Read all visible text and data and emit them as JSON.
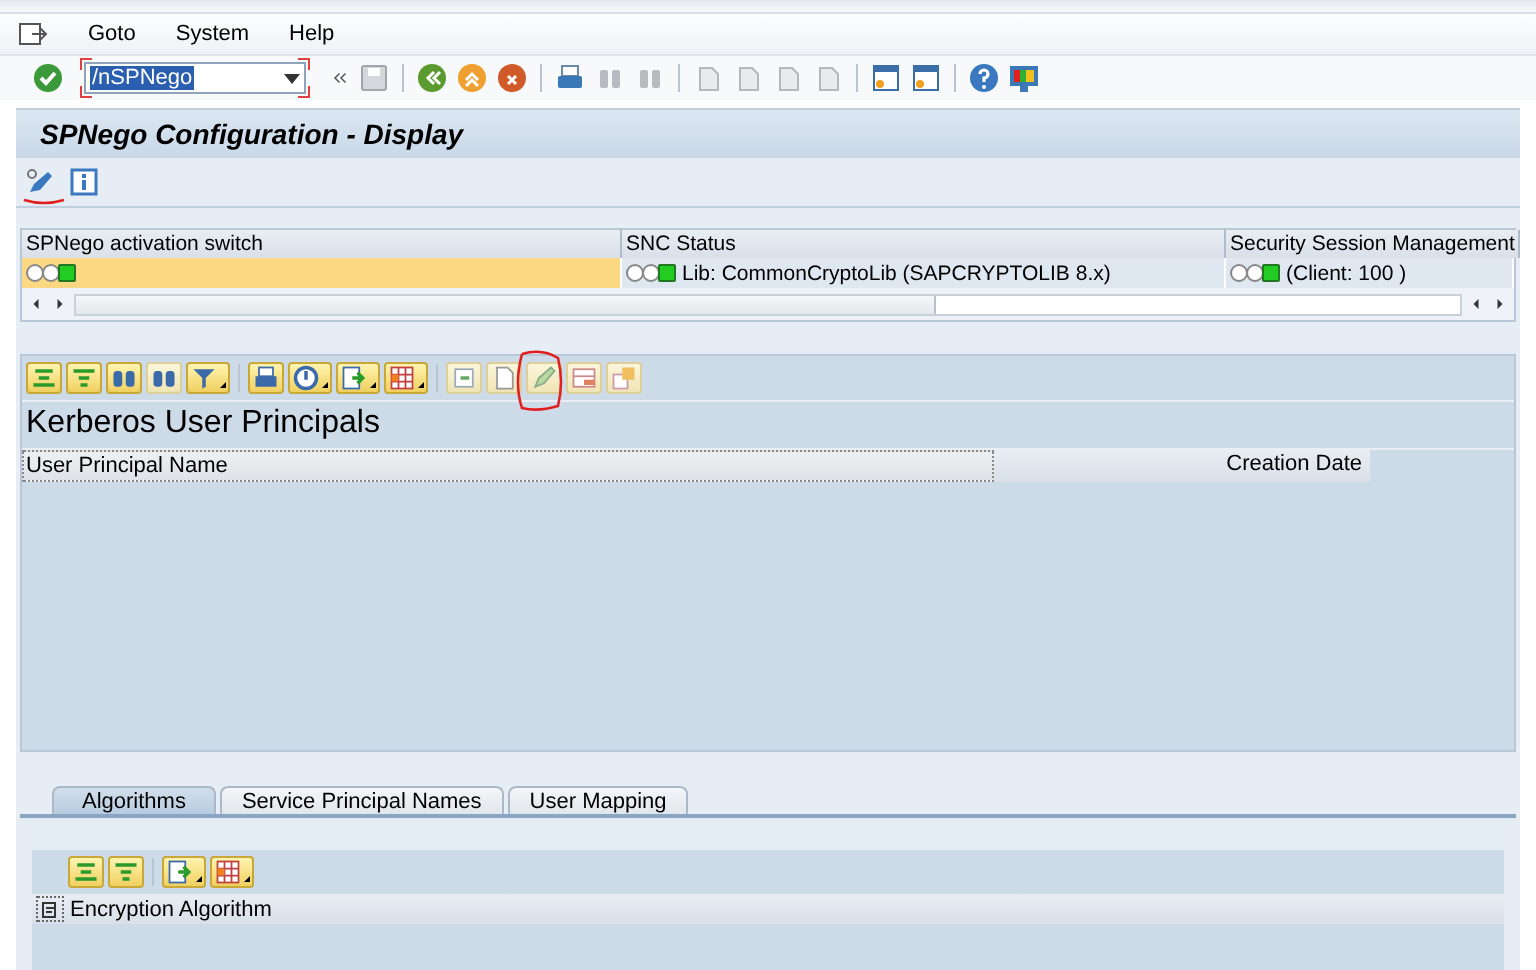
{
  "menu": [
    {
      "label": "Goto"
    },
    {
      "label": "System"
    },
    {
      "label": "Help"
    }
  ],
  "command_field": {
    "value": "/nSPNego"
  },
  "title": "SPNego Configuration - Display",
  "settings_table": {
    "columns": [
      "SPNego activation switch",
      "SNC Status",
      "Security Session Management"
    ],
    "rows": [
      {
        "cells": [
          {
            "lit": true,
            "highlighted": true
          },
          {
            "lit": true,
            "text": "Lib: CommonCryptoLib (SAPCRYPTOLIB 8.x)",
            "highlighted": false
          },
          {
            "lit": true,
            "text": "(Client: 100 )",
            "highlighted": false
          }
        ]
      }
    ]
  },
  "principals": {
    "title": "Kerberos User Principals",
    "columns": [
      "User Principal Name",
      "Creation Date"
    ]
  },
  "tabs": [
    {
      "label": "Algorithms",
      "selected": true
    },
    {
      "label": "Service Principal Names",
      "selected": false
    },
    {
      "label": "User Mapping",
      "selected": false
    }
  ],
  "algorithms": {
    "columns": [
      "Encryption Algorithm"
    ]
  }
}
